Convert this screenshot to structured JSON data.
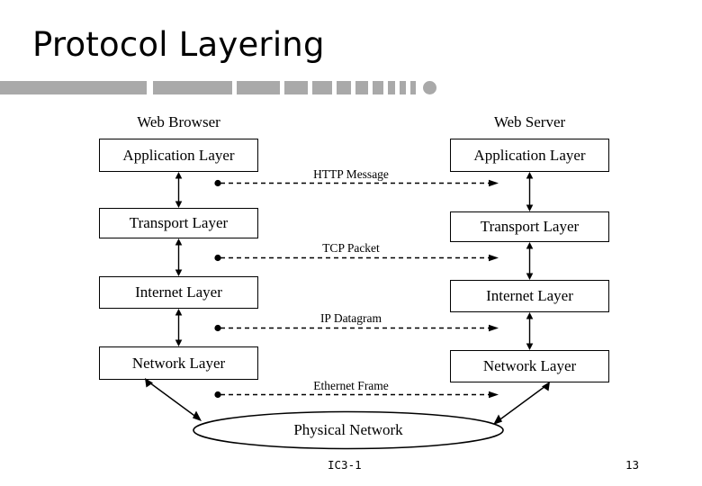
{
  "slide": {
    "title": "Protocol Layering",
    "accent_color": "#a9a9a9",
    "line_color": "#000000",
    "background_color": "#ffffff"
  },
  "columns": {
    "left": {
      "heading": "Web Browser",
      "layers": [
        {
          "label": "Application Layer"
        },
        {
          "label": "Transport Layer"
        },
        {
          "label": "Internet Layer"
        },
        {
          "label": "Network Layer"
        }
      ]
    },
    "right": {
      "heading": "Web Server",
      "layers": [
        {
          "label": "Application Layer"
        },
        {
          "label": "Transport Layer"
        },
        {
          "label": "Internet Layer"
        },
        {
          "label": "Network Layer"
        }
      ]
    }
  },
  "protocol_links": [
    {
      "label": "HTTP Message"
    },
    {
      "label": "TCP Packet"
    },
    {
      "label": "IP Datagram"
    },
    {
      "label": "Ethernet Frame"
    }
  ],
  "physical_network": {
    "label": "Physical Network"
  },
  "footer": {
    "code": "IC3-1",
    "page_number": "13"
  }
}
